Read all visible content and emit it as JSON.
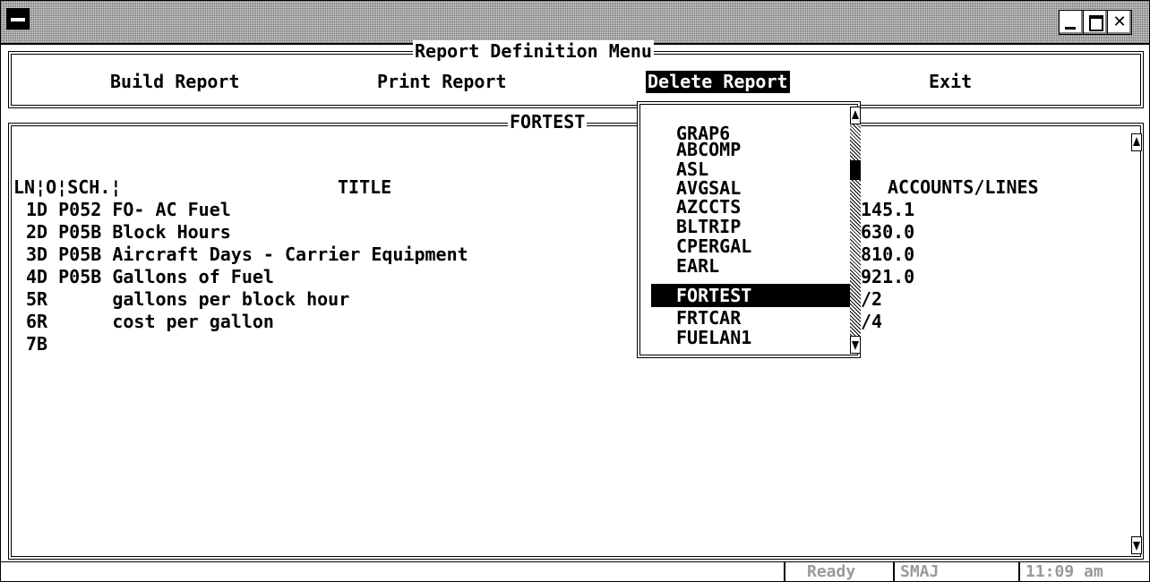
{
  "menu": {
    "title": "Report Definition Menu",
    "build": "Build Report",
    "print": "Print Report",
    "delete": "Delete Report",
    "exit": "Exit"
  },
  "document": {
    "title": "FORTEST",
    "headers": {
      "left": "LN¦O¦SCH.¦",
      "title": "TITLE",
      "accounts": "ACCOUNTS/LINES"
    },
    "rows": [
      {
        "text": "1D P052 FO- AC Fuel",
        "accounts": "145.1"
      },
      {
        "text": "2D P05B Block Hours",
        "accounts": "630.0"
      },
      {
        "text": "3D P05B Aircraft Days - Carrier Equipment",
        "accounts": "810.0"
      },
      {
        "text": "4D P05B Gallons of Fuel",
        "accounts": "921.0"
      },
      {
        "text": "5R      gallons per block hour",
        "accounts": "/2"
      },
      {
        "text": "6R      cost per gallon",
        "accounts": "/4"
      },
      {
        "text": "7B",
        "accounts": ""
      }
    ]
  },
  "dropdown": {
    "items": [
      "GRAP6",
      "ABCOMP",
      "ASL",
      "AVGSAL",
      "AZCCTS",
      "BLTRIP",
      "CPERGAL",
      "EARL",
      "FORTEST",
      "FRTCAR",
      "FUELAN1"
    ],
    "selected": "FORTEST"
  },
  "status": {
    "state": "Ready",
    "user": "SMAJ",
    "time": "11:09 am"
  }
}
